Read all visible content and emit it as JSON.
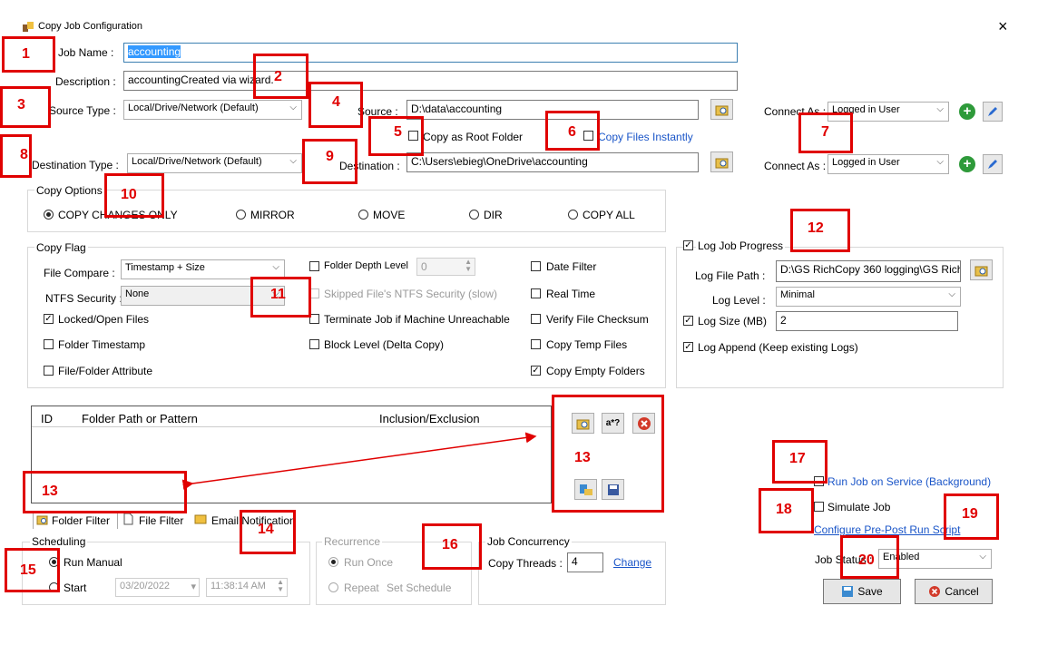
{
  "window": {
    "title": "Copy Job Configuration",
    "close": "×"
  },
  "job": {
    "name_label": "Job Name :",
    "name_value": "accounting",
    "desc_label": "Description :",
    "desc_value": "accountingCreated via wizard."
  },
  "source": {
    "type_label": "Source Type :",
    "type_value": "Local/Drive/Network (Default)",
    "path_label": "Source :",
    "path_value": "D:\\data\\accounting",
    "connect_label": "Connect As :",
    "connect_value": "Logged in User"
  },
  "options_row": {
    "copy_as_root": "Copy as Root Folder",
    "copy_instantly": "Copy Files Instantly"
  },
  "destination": {
    "type_label": "Destination Type :",
    "type_value": "Local/Drive/Network (Default)",
    "path_label": "Destination :",
    "path_value": "C:\\Users\\ebieg\\OneDrive\\accounting",
    "connect_label": "Connect As :",
    "connect_value": "Logged in User"
  },
  "copy_options": {
    "title": "Copy Options",
    "items": [
      "COPY CHANGES ONLY",
      "MIRROR",
      "MOVE",
      "DIR",
      "COPY ALL"
    ],
    "selected": "COPY CHANGES ONLY"
  },
  "copy_flag": {
    "title": "Copy Flag",
    "file_compare_label": "File Compare :",
    "file_compare_value": "Timestamp + Size",
    "ntfs_label": "NTFS Security :",
    "ntfs_value": "None",
    "locked_open": "Locked/Open Files",
    "folder_timestamp": "Folder Timestamp",
    "file_folder_attr": "File/Folder Attribute",
    "folder_depth": "Folder Depth Level",
    "folder_depth_value": "0",
    "skipped_ntfs": "Skipped File's NTFS Security (slow)",
    "terminate_job": "Terminate Job if Machine Unreachable",
    "block_level": "Block Level (Delta Copy)",
    "date_filter": "Date Filter",
    "real_time": "Real Time",
    "verify_checksum": "Verify File Checksum",
    "copy_temp": "Copy Temp Files",
    "copy_empty": "Copy Empty Folders"
  },
  "log": {
    "title": "Log Job Progress",
    "path_label": "Log File Path :",
    "path_value": "D:\\GS RichCopy 360 logging\\GS Rich",
    "level_label": "Log Level :",
    "level_value": "Minimal",
    "size_label": "Log Size (MB)",
    "size_value": "2",
    "append_label": "Log Append (Keep existing Logs)"
  },
  "filter_table": {
    "columns": [
      "ID",
      "Folder Path or Pattern",
      "Inclusion/Exclusion"
    ]
  },
  "tabs": [
    "Folder Filter",
    "File Filter",
    "Email Notification"
  ],
  "scheduling": {
    "title": "Scheduling",
    "run_manual": "Run Manual",
    "start": "Start",
    "date": "03/20/2022",
    "time": "11:38:14 AM"
  },
  "recurrence": {
    "title": "Recurrence",
    "run_once": "Run Once",
    "repeat": "Repeat",
    "set_schedule": "Set Schedule"
  },
  "concurrency": {
    "title": "Job Concurrency",
    "threads_label": "Copy Threads :",
    "threads_value": "4",
    "change": "Change"
  },
  "right_panel": {
    "run_on_service": "Run Job on Service (Background)",
    "simulate": "Simulate Job",
    "configure_script": "Configure Pre-Post Run Script",
    "status_label": "Job Status :",
    "status_value": "Enabled"
  },
  "buttons": {
    "save": "Save",
    "cancel": "Cancel",
    "regex": "a*?"
  },
  "annotations": [
    "1",
    "2",
    "3",
    "4",
    "5",
    "6",
    "7",
    "8",
    "9",
    "10",
    "11",
    "12",
    "13",
    "13",
    "14",
    "15",
    "16",
    "17",
    "18",
    "19",
    "20"
  ],
  "colors": {
    "annotation": "#e00000",
    "link": "#1a55c8",
    "selection": "#3399ff"
  }
}
